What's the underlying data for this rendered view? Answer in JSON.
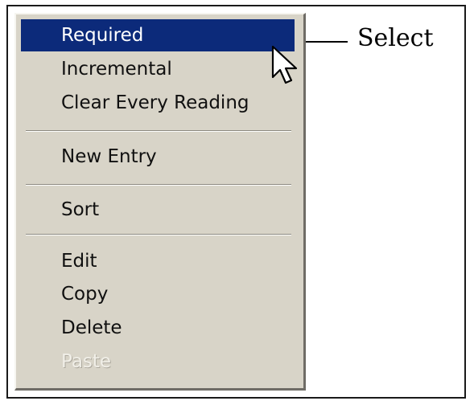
{
  "menu": {
    "items": [
      {
        "label": "Required",
        "state": "highlighted"
      },
      {
        "label": "Incremental",
        "state": "normal"
      },
      {
        "label": "Clear Every Reading",
        "state": "normal"
      },
      {
        "label": "New Entry",
        "state": "normal"
      },
      {
        "label": "Sort",
        "state": "normal"
      },
      {
        "label": "Edit",
        "state": "normal"
      },
      {
        "label": "Copy",
        "state": "normal"
      },
      {
        "label": "Delete",
        "state": "normal"
      },
      {
        "label": "Paste",
        "state": "disabled"
      }
    ]
  },
  "callout": {
    "label": "Select"
  },
  "icons": {
    "cursor": "mouse-pointer-icon"
  },
  "colors": {
    "highlight": "#0c2a7a",
    "menu_background": "#d8d4c8",
    "highlight_text": "#ffffff",
    "text": "#101010"
  }
}
